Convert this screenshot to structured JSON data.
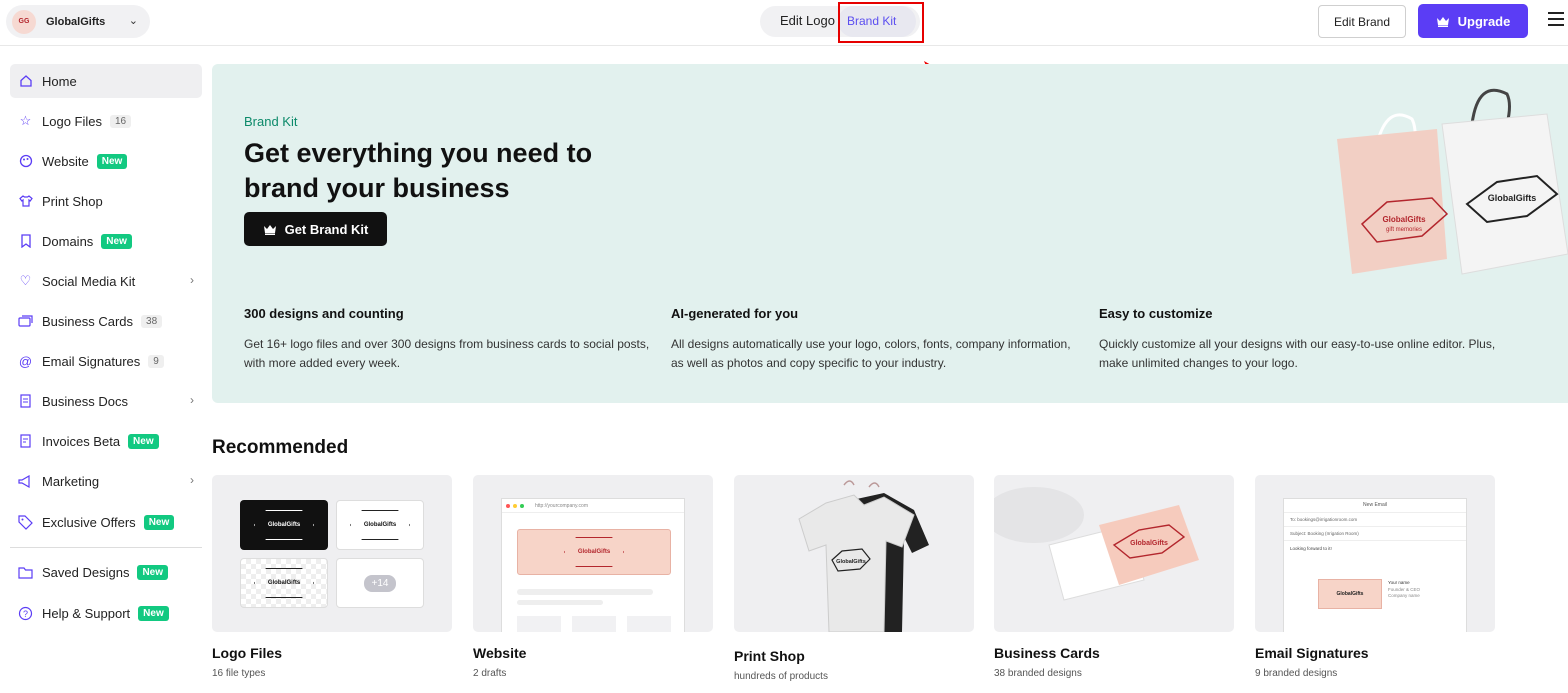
{
  "header": {
    "brand_name": "GlobalGifts",
    "brand_logo_text": "GG",
    "seg_edit_logo": "Edit Logo",
    "seg_brand_kit": "Brand Kit",
    "edit_brand": "Edit Brand",
    "upgrade": "Upgrade"
  },
  "sidebar": {
    "home": "Home",
    "logo_files": "Logo Files",
    "logo_files_count": "16",
    "website": "Website",
    "print_shop": "Print Shop",
    "domains": "Domains",
    "social_media_kit": "Social Media Kit",
    "business_cards": "Business Cards",
    "business_cards_count": "38",
    "email_signatures": "Email Signatures",
    "email_signatures_count": "9",
    "business_docs": "Business Docs",
    "invoices": "Invoices Beta",
    "marketing": "Marketing",
    "exclusive_offers": "Exclusive Offers",
    "saved_designs": "Saved Designs",
    "help_support": "Help & Support",
    "new_badge": "New"
  },
  "hero": {
    "eyebrow": "Brand Kit",
    "title": "Get everything you need to brand your business",
    "button": "Get Brand Kit",
    "features": [
      {
        "title": "300 designs and counting",
        "text": "Get 16+ logo files and over 300 designs from business cards to social posts, with more added every week."
      },
      {
        "title": "AI-generated for you",
        "text": "All designs automatically use your logo, colors, fonts, company information, as well as photos and copy specific to your industry."
      },
      {
        "title": "Easy to customize",
        "text": "Quickly customize all your designs with our easy-to-use online editor. Plus, make unlimited changes to your logo."
      }
    ],
    "bag_logo_text": "GlobalGifts",
    "bag_logo_sub": "gift memories"
  },
  "recommended": {
    "title": "Recommended",
    "cards": [
      {
        "label": "Logo Files",
        "sub": "16 file types"
      },
      {
        "label": "Website",
        "sub": "2 drafts"
      },
      {
        "label": "Print Shop",
        "sub": "hundreds of products"
      },
      {
        "label": "Business Cards",
        "sub": "38 branded designs"
      },
      {
        "label": "Email Signatures",
        "sub": "9 branded designs"
      }
    ],
    "logo_tile_text": "GlobalGifts",
    "logo_tile_sub": "gift memories",
    "plus_more": "+14",
    "website_url": "http://yourcompany.com",
    "email_title": "New Email",
    "email_to": "To: bookings@irrigationroom.com",
    "email_subject": "Subject: Booking (Irrigation Room)",
    "email_body": "Looking forward to it!",
    "email_name": "Your name",
    "email_role": "Founder & CEO",
    "email_company": "Company name"
  },
  "colors": {
    "accent": "#5b3df5",
    "new_badge": "#12c981",
    "hero_bg": "#e2f1ee",
    "highlight": "#e60000"
  }
}
